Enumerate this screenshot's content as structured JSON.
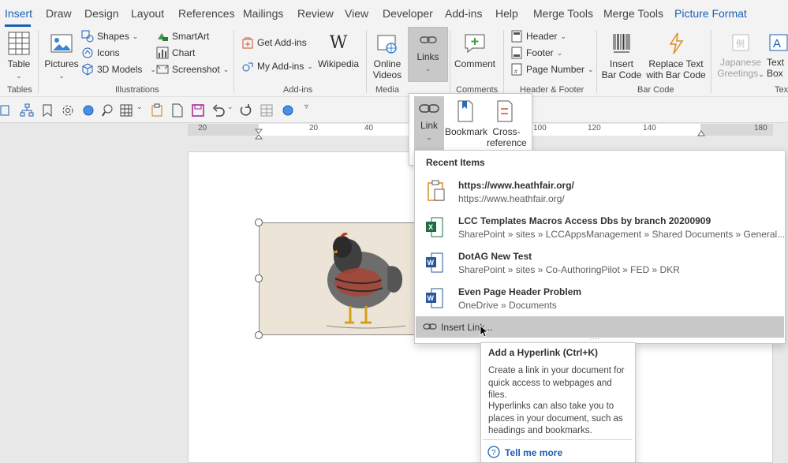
{
  "tabs": [
    "Insert",
    "Draw",
    "Design",
    "Layout",
    "References",
    "Mailings",
    "Review",
    "View",
    "Developer",
    "Add-ins",
    "Help",
    "Merge Tools",
    "Merge Tools",
    "Picture Format"
  ],
  "ribbon": {
    "tables": {
      "table": "Table",
      "group": "Tables"
    },
    "illustrations": {
      "pictures": "Pictures",
      "shapes": "Shapes",
      "icons": "Icons",
      "models": "3D Models",
      "smartart": "SmartArt",
      "chart": "Chart",
      "screenshot": "Screenshot",
      "group": "Illustrations"
    },
    "addins": {
      "get": "Get Add-ins",
      "my": "My Add-ins",
      "wikipedia": "Wikipedia",
      "group": "Add-ins"
    },
    "media": {
      "online1": "Online",
      "online2": "Videos",
      "group": "Media"
    },
    "links": {
      "label": "Links"
    },
    "comments": {
      "comment": "Comment",
      "group": "Comments"
    },
    "headerfooter": {
      "header": "Header",
      "footer": "Footer",
      "pagenum": "Page Number",
      "group": "Header & Footer"
    },
    "barcode": {
      "insert1": "Insert",
      "insert2": "Bar Code",
      "replace1": "Replace Text",
      "replace2": "with Bar Code",
      "group": "Bar Code"
    },
    "text": {
      "jg1": "Japanese",
      "jg2": "Greetings",
      "tb1": "Text",
      "tb2": "Box",
      "group": "Text"
    }
  },
  "ruler": {
    "ticks": [
      "20",
      "20",
      "40",
      "100",
      "120",
      "140",
      "180"
    ]
  },
  "links_menu": {
    "link": "Link",
    "bookmark": "Bookmark",
    "cross1": "Cross-",
    "cross2": "reference"
  },
  "recent": {
    "title": "Recent Items",
    "items": [
      {
        "title": "https://www.heathfair.org/",
        "sub": "https://www.heathfair.org/",
        "icon": "clipboard-icon"
      },
      {
        "title": "LCC Templates Macros Access Dbs by branch 20200909",
        "sub": "SharePoint » sites » LCCAppsManagement » Shared Documents » General...",
        "icon": "excel-icon"
      },
      {
        "title": "DotAG New Test",
        "sub": "SharePoint » sites » Co-AuthoringPilot » FED » DKR",
        "icon": "word-icon"
      },
      {
        "title": "Even Page Header Problem",
        "sub": "OneDrive » Documents",
        "icon": "word-icon"
      }
    ],
    "insert_link": "Insert Link..."
  },
  "tooltip": {
    "title": "Add a Hyperlink (Ctrl+K)",
    "p1": "Create a link in your document for quick access to webpages and files.",
    "p2": "Hyperlinks can also take you to places in your document, such as headings and bookmarks.",
    "more": "Tell me more"
  },
  "colors": {
    "accent": "#1b5fb5",
    "excel": "#1d6f42",
    "word": "#2b579a"
  }
}
